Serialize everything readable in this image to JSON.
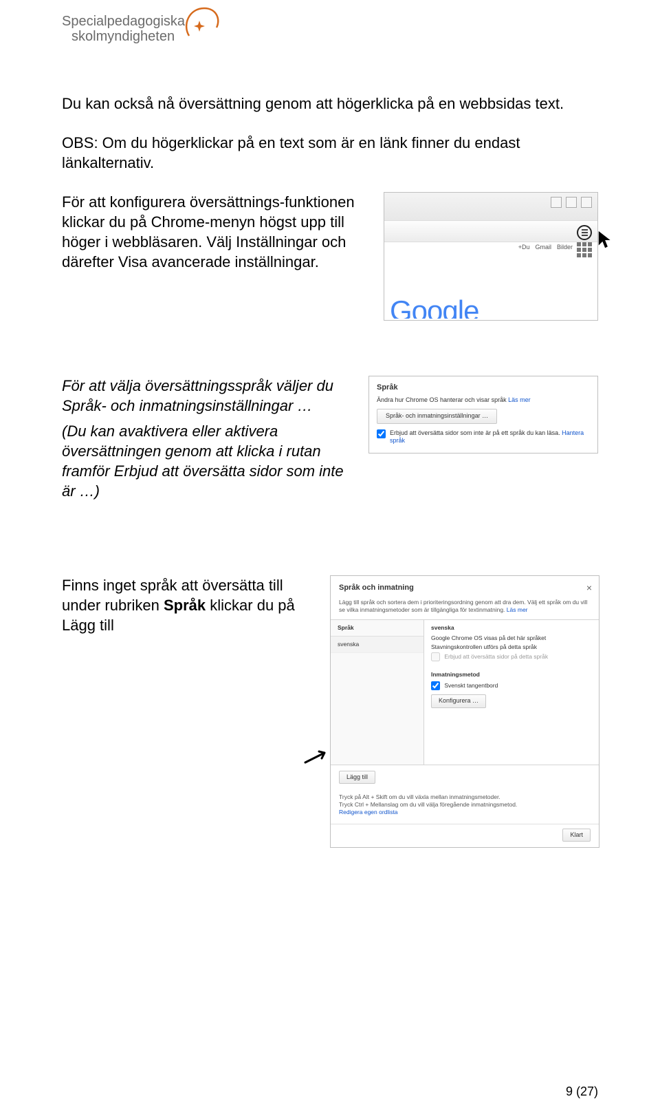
{
  "logo": {
    "line1": "Specialpedagogiska",
    "line2": "skolmyndigheten"
  },
  "p1": "Du kan också nå översättning genom att högerklicka på en webbsidas text.",
  "p2": "OBS: Om du högerklickar på en text som är en länk finner du endast länkalternativ.",
  "p3": "För att konfigurera översättnings-funktionen klickar du på Chrome-menyn högst upp till höger i webbläsaren. Välj Inställningar och därefter Visa avancerade inställningar.",
  "p4a": "För att välja översättningsspråk väljer du Språk- och inmatningsinställningar …",
  "p4b": "(Du kan avaktivera eller aktivera översättningen genom att klicka i rutan framför Erbjud att översätta sidor som inte är …)",
  "p5a": "Finns inget språk att översätta till under rubriken ",
  "p5bold": "Språk",
  "p5b": " klickar du på Lägg till",
  "fig1": {
    "links": {
      "du": "+Du",
      "gmail": "Gmail",
      "bilder": "Bilder"
    },
    "google": "Google"
  },
  "fig2": {
    "title": "Språk",
    "line1a": "Ändra hur Chrome OS hanterar och visar språk ",
    "line1link": "Läs mer",
    "button": "Språk- och inmatningsinställningar …",
    "cb_label_a": "Erbjud att översätta sidor som inte är på ett språk du kan läsa. ",
    "cb_label_link": "Hantera språk"
  },
  "fig3": {
    "title": "Språk och inmatning",
    "close": "×",
    "hint_a": "Lägg till språk och sortera dem i prioriteringsordning genom att dra dem. Välj ett språk om du vill se vilka inmatningsmetoder som är tillgängliga för textinmatning. ",
    "hint_link": "Läs mer",
    "col_header": "Språk",
    "left_item": "svenska",
    "right_lang": "svenska",
    "r1": "Google Chrome OS visas på det här språket",
    "r2": "Stavningskontrollen utförs på detta språk",
    "r3": "Erbjud att översätta sidor på detta språk",
    "sec": "Inmatningsmetod",
    "kb": "Svenskt tangentbord",
    "konfig": "Konfigurera …",
    "add": "Lägg till",
    "f1": "Tryck på Alt + Skift om du vill växla mellan inmatningsmetoder.",
    "f2": "Tryck Ctrl + Mellanslag om du vill välja föregående inmatningsmetod.",
    "f_link": "Redigera egen ordlista",
    "done": "Klart"
  },
  "footer": "9 (27)"
}
